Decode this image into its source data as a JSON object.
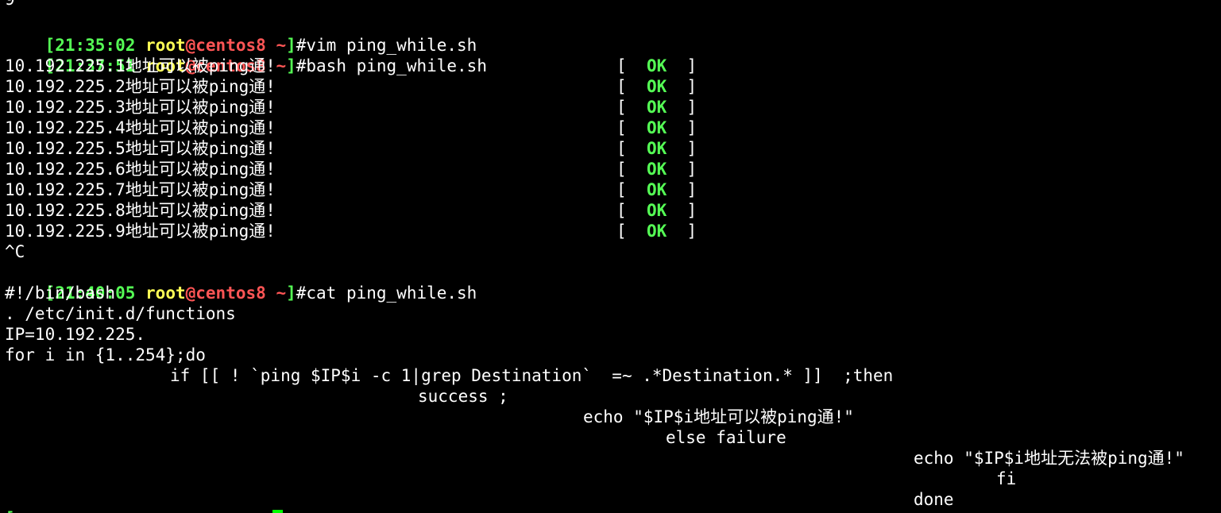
{
  "terminal": {
    "top_fragment": "9",
    "prompts": [
      {
        "time": "[21:35:02",
        "user": "root",
        "at": "@",
        "host": "centos8",
        "tilde": "~",
        "close": "]",
        "cmd": "#vim ping_while.sh"
      },
      {
        "time": "[21:37:51",
        "user": "root",
        "at": "@",
        "host": "centos8",
        "tilde": "~",
        "close": "]",
        "cmd": "#bash ping_while.sh"
      },
      {
        "time": "[21:40:05",
        "user": "root",
        "at": "@",
        "host": "centos8",
        "tilde": "~",
        "close": "]",
        "cmd": "#cat ping_while.sh"
      }
    ],
    "results": [
      {
        "text": "10.192.225.1地址可以被ping通!",
        "status": "OK"
      },
      {
        "text": "10.192.225.2地址可以被ping通!",
        "status": "OK"
      },
      {
        "text": "10.192.225.3地址可以被ping通!",
        "status": "OK"
      },
      {
        "text": "10.192.225.4地址可以被ping通!",
        "status": "OK"
      },
      {
        "text": "10.192.225.5地址可以被ping通!",
        "status": "OK"
      },
      {
        "text": "10.192.225.6地址可以被ping通!",
        "status": "OK"
      },
      {
        "text": "10.192.225.7地址可以被ping通!",
        "status": "OK"
      },
      {
        "text": "10.192.225.8地址可以被ping通!",
        "status": "OK"
      },
      {
        "text": "10.192.225.9地址可以被ping通!",
        "status": "OK"
      }
    ],
    "status_open": "[",
    "status_close": "]",
    "interrupt": "^C",
    "script_lines": [
      "#!/bin/bash",
      ". /etc/init.d/functions",
      "IP=10.192.225.",
      "for i in {1..254};do",
      "if [[ ! `ping $IP$i -c 1|grep Destination`  =~ .*Destination.* ]]  ;then",
      "success ;",
      "echo \"$IP$i地址可以被ping通!\"",
      "else failure",
      "echo \"$IP$i地址无法被ping通!\"",
      "fi",
      "done"
    ],
    "last_prompt_fragment": "[",
    "colors": {
      "background": "#000000",
      "foreground": "#ffffff",
      "green": "#55ff55",
      "yellow": "#ffff55",
      "red": "#ff5555",
      "cursor": "#00ff00"
    }
  }
}
